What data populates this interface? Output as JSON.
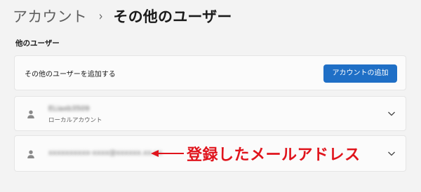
{
  "breadcrumb": {
    "parent": "アカウント",
    "separator": "›",
    "current": "その他のユーザー"
  },
  "section": {
    "heading": "他のユーザー"
  },
  "add_user": {
    "label": "その他のユーザーを追加する",
    "button_label": "アカウントの追加"
  },
  "users": [
    {
      "name": "ELiaxb3509",
      "type": "ローカルアカウント",
      "icon": "person-icon"
    },
    {
      "name": "xxxxxxxxxx-xxxx@xxxxxx.xx.xx",
      "icon": "person-icon"
    }
  ],
  "annotation": {
    "text": "登録したメールアドレス",
    "color": "#e0141c"
  },
  "colors": {
    "accent": "#1f6fc6",
    "background": "#f3f3f3",
    "card": "#fbfbfb"
  }
}
